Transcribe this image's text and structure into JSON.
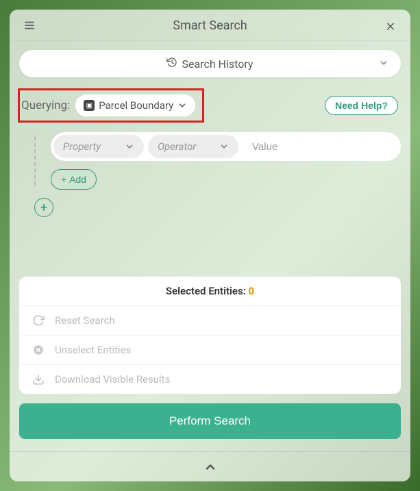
{
  "header": {
    "title": "Smart Search"
  },
  "search_history_label": "Search History",
  "querying": {
    "label": "Querying:",
    "layer": "Parcel Boundary"
  },
  "need_help_label": "Need Help?",
  "condition": {
    "property_placeholder": "Property",
    "operator_placeholder": "Operator",
    "value_placeholder": "Value"
  },
  "add_label": "Add",
  "selected_entities": {
    "label": "Selected Entities: ",
    "count": "0"
  },
  "actions": {
    "reset": "Reset Search",
    "unselect": "Unselect Entities",
    "download": "Download Visible Results"
  },
  "perform_label": "Perform Search"
}
